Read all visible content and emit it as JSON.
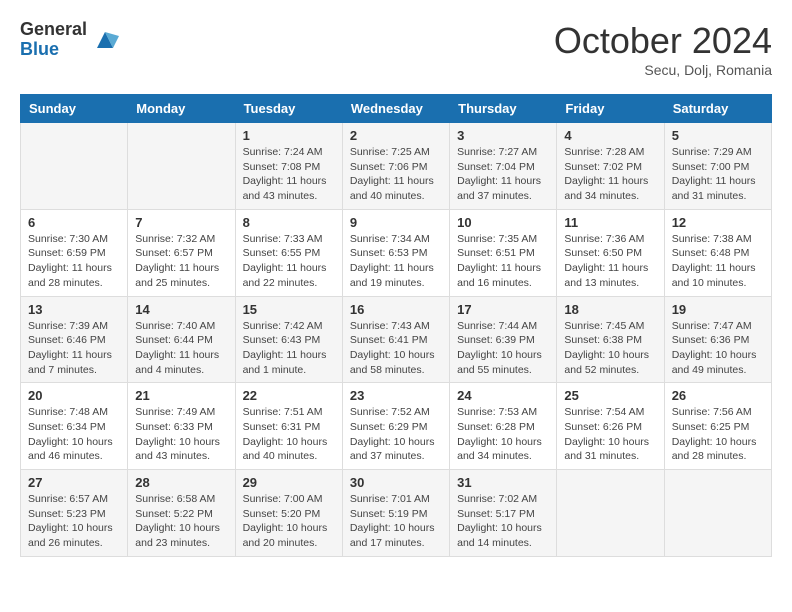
{
  "header": {
    "logo_general": "General",
    "logo_blue": "Blue",
    "month": "October 2024",
    "location": "Secu, Dolj, Romania"
  },
  "days_of_week": [
    "Sunday",
    "Monday",
    "Tuesday",
    "Wednesday",
    "Thursday",
    "Friday",
    "Saturday"
  ],
  "weeks": [
    [
      {
        "day": "",
        "content": ""
      },
      {
        "day": "",
        "content": ""
      },
      {
        "day": "1",
        "content": "Sunrise: 7:24 AM\nSunset: 7:08 PM\nDaylight: 11 hours and 43 minutes."
      },
      {
        "day": "2",
        "content": "Sunrise: 7:25 AM\nSunset: 7:06 PM\nDaylight: 11 hours and 40 minutes."
      },
      {
        "day": "3",
        "content": "Sunrise: 7:27 AM\nSunset: 7:04 PM\nDaylight: 11 hours and 37 minutes."
      },
      {
        "day": "4",
        "content": "Sunrise: 7:28 AM\nSunset: 7:02 PM\nDaylight: 11 hours and 34 minutes."
      },
      {
        "day": "5",
        "content": "Sunrise: 7:29 AM\nSunset: 7:00 PM\nDaylight: 11 hours and 31 minutes."
      }
    ],
    [
      {
        "day": "6",
        "content": "Sunrise: 7:30 AM\nSunset: 6:59 PM\nDaylight: 11 hours and 28 minutes."
      },
      {
        "day": "7",
        "content": "Sunrise: 7:32 AM\nSunset: 6:57 PM\nDaylight: 11 hours and 25 minutes."
      },
      {
        "day": "8",
        "content": "Sunrise: 7:33 AM\nSunset: 6:55 PM\nDaylight: 11 hours and 22 minutes."
      },
      {
        "day": "9",
        "content": "Sunrise: 7:34 AM\nSunset: 6:53 PM\nDaylight: 11 hours and 19 minutes."
      },
      {
        "day": "10",
        "content": "Sunrise: 7:35 AM\nSunset: 6:51 PM\nDaylight: 11 hours and 16 minutes."
      },
      {
        "day": "11",
        "content": "Sunrise: 7:36 AM\nSunset: 6:50 PM\nDaylight: 11 hours and 13 minutes."
      },
      {
        "day": "12",
        "content": "Sunrise: 7:38 AM\nSunset: 6:48 PM\nDaylight: 11 hours and 10 minutes."
      }
    ],
    [
      {
        "day": "13",
        "content": "Sunrise: 7:39 AM\nSunset: 6:46 PM\nDaylight: 11 hours and 7 minutes."
      },
      {
        "day": "14",
        "content": "Sunrise: 7:40 AM\nSunset: 6:44 PM\nDaylight: 11 hours and 4 minutes."
      },
      {
        "day": "15",
        "content": "Sunrise: 7:42 AM\nSunset: 6:43 PM\nDaylight: 11 hours and 1 minute."
      },
      {
        "day": "16",
        "content": "Sunrise: 7:43 AM\nSunset: 6:41 PM\nDaylight: 10 hours and 58 minutes."
      },
      {
        "day": "17",
        "content": "Sunrise: 7:44 AM\nSunset: 6:39 PM\nDaylight: 10 hours and 55 minutes."
      },
      {
        "day": "18",
        "content": "Sunrise: 7:45 AM\nSunset: 6:38 PM\nDaylight: 10 hours and 52 minutes."
      },
      {
        "day": "19",
        "content": "Sunrise: 7:47 AM\nSunset: 6:36 PM\nDaylight: 10 hours and 49 minutes."
      }
    ],
    [
      {
        "day": "20",
        "content": "Sunrise: 7:48 AM\nSunset: 6:34 PM\nDaylight: 10 hours and 46 minutes."
      },
      {
        "day": "21",
        "content": "Sunrise: 7:49 AM\nSunset: 6:33 PM\nDaylight: 10 hours and 43 minutes."
      },
      {
        "day": "22",
        "content": "Sunrise: 7:51 AM\nSunset: 6:31 PM\nDaylight: 10 hours and 40 minutes."
      },
      {
        "day": "23",
        "content": "Sunrise: 7:52 AM\nSunset: 6:29 PM\nDaylight: 10 hours and 37 minutes."
      },
      {
        "day": "24",
        "content": "Sunrise: 7:53 AM\nSunset: 6:28 PM\nDaylight: 10 hours and 34 minutes."
      },
      {
        "day": "25",
        "content": "Sunrise: 7:54 AM\nSunset: 6:26 PM\nDaylight: 10 hours and 31 minutes."
      },
      {
        "day": "26",
        "content": "Sunrise: 7:56 AM\nSunset: 6:25 PM\nDaylight: 10 hours and 28 minutes."
      }
    ],
    [
      {
        "day": "27",
        "content": "Sunrise: 6:57 AM\nSunset: 5:23 PM\nDaylight: 10 hours and 26 minutes."
      },
      {
        "day": "28",
        "content": "Sunrise: 6:58 AM\nSunset: 5:22 PM\nDaylight: 10 hours and 23 minutes."
      },
      {
        "day": "29",
        "content": "Sunrise: 7:00 AM\nSunset: 5:20 PM\nDaylight: 10 hours and 20 minutes."
      },
      {
        "day": "30",
        "content": "Sunrise: 7:01 AM\nSunset: 5:19 PM\nDaylight: 10 hours and 17 minutes."
      },
      {
        "day": "31",
        "content": "Sunrise: 7:02 AM\nSunset: 5:17 PM\nDaylight: 10 hours and 14 minutes."
      },
      {
        "day": "",
        "content": ""
      },
      {
        "day": "",
        "content": ""
      }
    ]
  ]
}
